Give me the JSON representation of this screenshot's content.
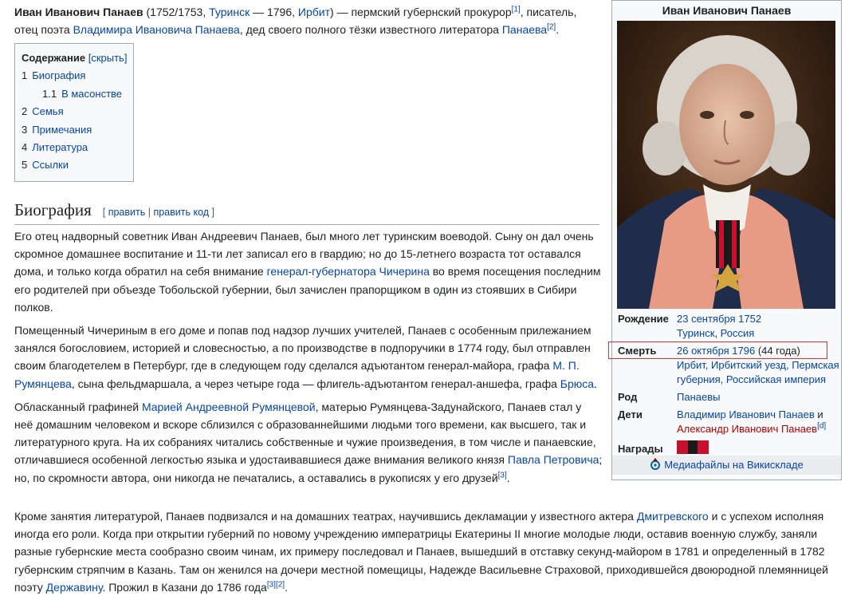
{
  "intro": {
    "name": "Иван Иванович Панаев",
    "years_open": " (1752/1753, ",
    "birth_place": "Туринск",
    "dash": " — 1796, ",
    "death_place": "Ирбит",
    "desc1": ") — пермский губернский прокурор",
    "ref1": "[1]",
    "desc2": ", писатель, отец поэта ",
    "father_link": "Владимира Ивановича Панаева",
    "desc3": ", дед своего полного тёзки известного литератора ",
    "grandson_link": "Панаева",
    "ref2": "[2]",
    "end": "."
  },
  "toc": {
    "title": "Содержание",
    "toggle": "[скрыть]",
    "items": [
      {
        "num": "1",
        "label": "Биография"
      },
      {
        "num": "1.1",
        "label": "В масонстве"
      },
      {
        "num": "2",
        "label": "Семья"
      },
      {
        "num": "3",
        "label": "Примечания"
      },
      {
        "num": "4",
        "label": "Литература"
      },
      {
        "num": "5",
        "label": "Ссылки"
      }
    ]
  },
  "section": {
    "title": "Биография",
    "edit_open": "[ ",
    "edit": "править",
    "sep": " | ",
    "edit_code": "править код",
    "edit_close": " ]"
  },
  "paragraphs": {
    "p1a": "Его отец надворный советник Иван Андреевич Панаев, был много лет туринским воеводой. Сыну он дал очень скромное домашнее воспитание и 11-ти лет записал его в гвардию; но до 15-летнего возраста тот оставался дома, и только когда обратил на себя внимание ",
    "p1_link": "генерал-губернатора Чичерина",
    "p1b": " во время посещения последним его родителей при объезде Тобольской губернии, был зачислен прапорщиком в один из стоявших в Сибири полков.",
    "p2a": "Помещенный Чичериным в его доме и попав под надзор лучших учителей, Панаев с особенным прилежанием занялся богословием, историей и словесностью, а по производстве в подпоручики в 1774 году, был отправлен своим благодетелем в Петербург, где в следующем году сделался адъютантом генерал-майора, графа ",
    "p2_link1": "М. П. Румянцева",
    "p2b": ", сына фельдмаршала, а через четыре года — флигель-адъютантом генерал-аншефа, графа ",
    "p2_link2": "Брюса",
    "p2c": ".",
    "p3a": "Обласканный графиней ",
    "p3_link1": "Марией Андреевной Румянцевой",
    "p3b": ", матерью Румянцева-Задунайского, Панаев стал у неё домашним человеком и вскоре сблизился с образованнейшими людьми того времени, как высшего, так и литературного круга. На их собраниях читались собственные и чужие произведения, в том числе и панаевские, отличавшиеся особенной легкостью языка и удостаивавшиеся даже внимания великого князя ",
    "p3_link2": "Павла Петровича",
    "p3c": "; но, по скромности автора, они никогда не печатались, а оставались в рукописях у его друзей",
    "p3_ref": "[3]",
    "p3d": ".",
    "p4a": "Кроме занятия литературой, Панаев подвизался и на домашних театрах, научившись декламации у известного актера ",
    "p4_link1": "Дмитревского",
    "p4b": " и с успехом исполняя иногда его роли. Когда при открытии губерний по новому учреждению императрицы Екатерины II многие молодые люди, оставив военную службу, заняли разные губернские места сообразно своим чинам, их примеру последовал и Панаев, вышедший в отставку секунд-майором в 1781 и определенный в 1782 губернским стряпчим в Казань. Там он женился на дочери местной помещицы, Надежде Васильевне Страховой, приходившейся двоюродной племянницей поэту ",
    "p4_link2": "Державину",
    "p4c": ". Прожил в Казани до 1786 года",
    "p4_ref": "[3][2]",
    "p4d": "."
  },
  "infobox": {
    "title": "Иван Иванович Панаев",
    "birth_label": "Рождение",
    "birth_date": "23 сентября 1752",
    "birth_place": "Туринск",
    "birth_comma": ", ",
    "birth_country": "Россия",
    "death_label": "Смерть",
    "death_date": "26 октября 1796",
    "death_age": " (44 года)",
    "death_place": "Ирбит, Ирбитский уезд, Пермская губерния, Российская империя",
    "family_label": "Род",
    "family": "Панаевы",
    "children_label": "Дети",
    "child1": "Владимир Иванович Панаев",
    "child_and": " и",
    "child2": "Александр Иванович Панаев",
    "child2_ref": "[d]",
    "awards_label": "Награды",
    "commons": "Медиафайлы на Викискладе",
    "ribbon_colors": [
      "#c8102e",
      "#1a1a1a",
      "#c8102e"
    ]
  }
}
